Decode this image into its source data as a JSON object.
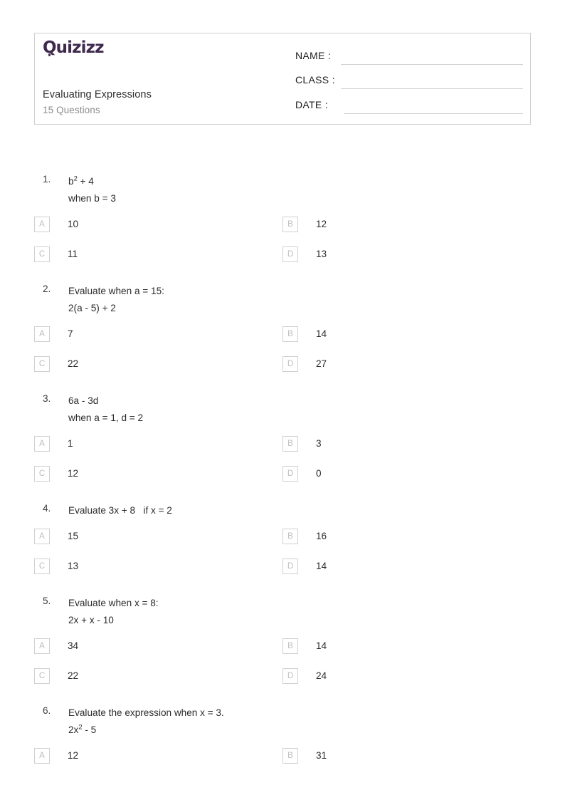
{
  "header": {
    "logo_text": "Quizizz",
    "logo_color": "#3f2a4d",
    "logo_q": "Q",
    "logo_rest": "uizizz",
    "title": "Evaluating Expressions",
    "subtitle": "15 Questions",
    "fields": [
      {
        "label": "NAME :",
        "value": ""
      },
      {
        "label": "CLASS :",
        "value": ""
      },
      {
        "label": "DATE  :",
        "value": ""
      }
    ]
  },
  "questions": [
    {
      "number": "1.",
      "lines": [
        "b",
        "when b = 3"
      ],
      "line1_base": "b",
      "line1_sup": "2",
      "line1_tail": " + 4",
      "line2": "when b = 3",
      "options": [
        {
          "letter": "A",
          "text": "10"
        },
        {
          "letter": "B",
          "text": "12"
        },
        {
          "letter": "C",
          "text": "11"
        },
        {
          "letter": "D",
          "text": "13"
        }
      ]
    },
    {
      "number": "2.",
      "line1_base": "Evaluate when a = 15:",
      "line1_sup": "",
      "line1_tail": "",
      "line2": "2(a - 5) + 2",
      "options": [
        {
          "letter": "A",
          "text": "7"
        },
        {
          "letter": "B",
          "text": "14"
        },
        {
          "letter": "C",
          "text": "22"
        },
        {
          "letter": "D",
          "text": "27"
        }
      ]
    },
    {
      "number": "3.",
      "line1_base": "6a - 3d",
      "line1_sup": "",
      "line1_tail": "",
      "line2": "when a = 1, d = 2",
      "options": [
        {
          "letter": "A",
          "text": "1"
        },
        {
          "letter": "B",
          "text": "3"
        },
        {
          "letter": "C",
          "text": "12"
        },
        {
          "letter": "D",
          "text": "0"
        }
      ]
    },
    {
      "number": "4.",
      "line1_base": "Evaluate 3x + 8   if x = 2",
      "line1_sup": "",
      "line1_tail": "",
      "line2": "",
      "options": [
        {
          "letter": "A",
          "text": "15"
        },
        {
          "letter": "B",
          "text": "16"
        },
        {
          "letter": "C",
          "text": "13"
        },
        {
          "letter": "D",
          "text": "14"
        }
      ]
    },
    {
      "number": "5.",
      "line1_base": "Evaluate when x = 8:",
      "line1_sup": "",
      "line1_tail": "",
      "line2": "2x + x - 10",
      "options": [
        {
          "letter": "A",
          "text": "34"
        },
        {
          "letter": "B",
          "text": "14"
        },
        {
          "letter": "C",
          "text": "22"
        },
        {
          "letter": "D",
          "text": "24"
        }
      ]
    },
    {
      "number": "6.",
      "line1_base": "Evaluate the expression when x = 3.",
      "line1_sup": "",
      "line1_tail": "",
      "line2_base": "2x",
      "line2_sup": "2",
      "line2_tail": " - 5",
      "line2": "",
      "options": [
        {
          "letter": "A",
          "text": "12"
        },
        {
          "letter": "B",
          "text": "31"
        }
      ]
    }
  ]
}
